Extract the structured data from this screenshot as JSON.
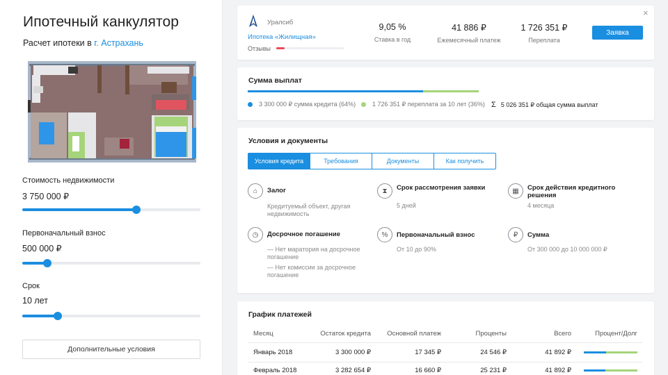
{
  "calculator": {
    "title": "Ипотечный канкулятор",
    "city_prefix": "Расчет ипотеки в",
    "city": "г. Астрахань",
    "fields": [
      {
        "label": "Стоимость недвижимости",
        "value": "3 750 000 ₽",
        "slider_fraction": 0.64
      },
      {
        "label": "Первоначальный взнос",
        "value": "500 000 ₽",
        "slider_fraction": 0.14
      },
      {
        "label": "Срок",
        "value": "10 лет",
        "slider_fraction": 0.2
      }
    ],
    "extra_button": "Дополнительные условия"
  },
  "offer": {
    "bank": "Уралсиб",
    "product": "Ипотека «Жилищная»",
    "reviews_label": "Отзывы",
    "reviews_fraction": 0.12,
    "rate": {
      "value": "9,05 %",
      "label": "Ставка в год"
    },
    "payment": {
      "value": "41 886 ₽",
      "label": "Ежемесячный платеж"
    },
    "overpay": {
      "value": "1 726 351 ₽",
      "label": "Переплата"
    },
    "apply_button": "Заявка",
    "close": "×",
    "colors": {
      "accent": "#1a8ee0",
      "secondary": "#a6d47a",
      "reviews": "#e94b5b"
    }
  },
  "sum": {
    "title": "Сумма выплат",
    "credit_fraction": 0.76,
    "credit": "3 300 000 ₽ сумма кредита (64%)",
    "overpay": "1 726 351 ₽ переплата за 10 лет (36%)",
    "sigma": "Σ",
    "total": "5 026 351 ₽ общая сумма выплат"
  },
  "conditions": {
    "title": "Условия и документы",
    "tabs": [
      "Условия кредита",
      "Требования",
      "Документы",
      "Как получить"
    ],
    "active_tab": 0,
    "items": [
      {
        "icon": "house-icon",
        "title": "Залог",
        "desc": [
          "Кредитуемый объект, другая недвижимость"
        ]
      },
      {
        "icon": "hourglass-icon",
        "title": "Срок рассмотрения заявки",
        "desc": [
          "5 дней"
        ]
      },
      {
        "icon": "calendar-icon",
        "title": "Срок действия кредитного решения",
        "desc": [
          "4 месяца"
        ]
      },
      {
        "icon": "document-clock-icon",
        "title": "Досрочное погашение",
        "desc": [
          "— Нет маратория на досрочное погашение",
          "— Нет комиссии за досрочное погашение"
        ]
      },
      {
        "icon": "percent-icon",
        "title": "Первоначальный взнос",
        "desc": [
          "От 10 до 90%"
        ]
      },
      {
        "icon": "money-bag-icon",
        "title": "Сумма",
        "desc": [
          "От 300 000 до 10 000 000 ₽"
        ]
      }
    ]
  },
  "schedule": {
    "title": "График платежей",
    "columns": [
      "Месяц",
      "Остаток кредита",
      "Основной платеж",
      "Проценты",
      "Всего",
      "Процент/Долг"
    ],
    "rows": [
      {
        "month": "Январь 2018",
        "balance": "3 300 000 ₽",
        "principal": "17 345 ₽",
        "interest": "24 546 ₽",
        "total": "41 892 ₽",
        "principal_share": 0.41
      },
      {
        "month": "Февраль 2018",
        "balance": "3 282 654 ₽",
        "principal": "16 660 ₽",
        "interest": "25 231 ₽",
        "total": "41 892 ₽",
        "principal_share": 0.4
      }
    ]
  }
}
